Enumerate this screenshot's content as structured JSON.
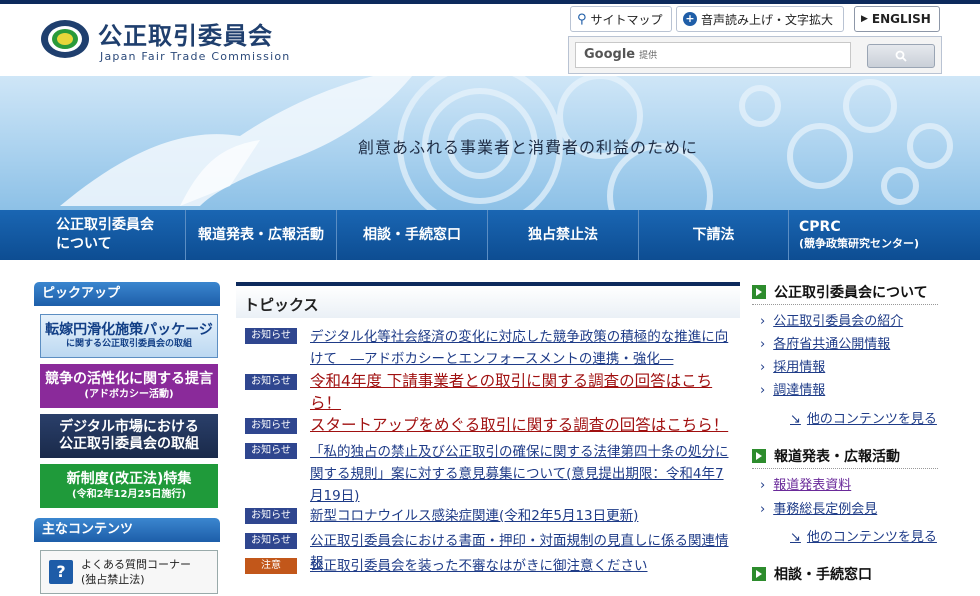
{
  "header": {
    "title_ja": "公正取引委員会",
    "title_en": "Japan Fair Trade Commission",
    "tools": {
      "sitemap": "サイトマップ",
      "speech": "音声読み上げ・文字拡大",
      "english": "ENGLISH"
    },
    "search": {
      "provider": "Google",
      "provided": "提供"
    }
  },
  "hero": {
    "tagline": "創意あふれる事業者と消費者の利益のために"
  },
  "nav": {
    "items": [
      {
        "label": "公正取引委員会",
        "sub": "について"
      },
      {
        "label": "報道発表・広報活動"
      },
      {
        "label": "相談・手続窓口"
      },
      {
        "label": "独占禁止法"
      },
      {
        "label": "下請法"
      },
      {
        "label": "CPRC",
        "sub": "(競争政策研究センター)"
      }
    ]
  },
  "sidebar": {
    "pickup_title": "ピックアップ",
    "banners": [
      {
        "l1": "転嫁円滑化施策パッケージ",
        "l2": "に関する公正取引委員会の取組"
      },
      {
        "l1": "競争の活性化に関する提言",
        "l2": "(アドボカシー活動)"
      },
      {
        "l1": "デジタル市場における",
        "l2": "公正取引委員会の取組"
      },
      {
        "l1": "新制度(改正法)特集",
        "l2": "(令和2年12月25日施行)"
      }
    ],
    "main_title": "主なコンテンツ",
    "faq": {
      "l1": "よくある質問コーナー",
      "l2": "(独占禁止法)"
    }
  },
  "topics": {
    "title": "トピックス",
    "items": [
      {
        "tag": "お知らせ",
        "text": "デジタル化等社会経済の変化に対応した競争政策の積極的な推進に向けて　―アドボカシーとエンフォースメントの連携・強化―"
      },
      {
        "tag": "お知らせ",
        "text": "令和4年度 下請事業者との取引に関する調査の回答はこちら！"
      },
      {
        "tag": "お知らせ",
        "text": "スタートアップをめぐる取引に関する調査の回答はこちら！"
      },
      {
        "tag": "お知らせ",
        "text": "「私的独占の禁止及び公正取引の確保に関する法律第四十条の処分に関する規則」案に対する意見募集について(意見提出期限：令和4年7月19日)"
      },
      {
        "tag": "お知らせ",
        "text": "新型コロナウイルス感染症関連(令和2年5月13日更新)"
      },
      {
        "tag": "お知らせ",
        "text": "公正取引委員会における書面・押印・対面規制の見直しに係る関連情報"
      },
      {
        "tag": "注意",
        "text": "公正取引委員会を装った不審なはがきに御注意ください"
      }
    ]
  },
  "right": {
    "sections": [
      {
        "title": "公正取引委員会について",
        "links": [
          "公正取引委員会の紹介",
          "各府省共通公開情報",
          "採用情報",
          "調達情報"
        ],
        "more": "他のコンテンツを見る"
      },
      {
        "title": "報道発表・広報活動",
        "links": [
          "報道発表資料",
          "事務総長定例会見"
        ],
        "more": "他のコンテンツを見る"
      },
      {
        "title": "相談・手続窓口"
      }
    ]
  }
}
